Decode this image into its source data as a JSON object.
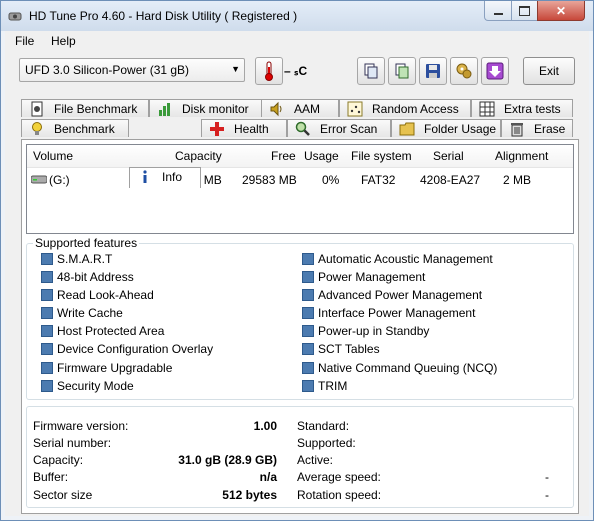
{
  "window": {
    "title": "HD Tune Pro 4.60 - Hard Disk Utility (  Registered )"
  },
  "menu": [
    "File",
    "Help"
  ],
  "toolbar": {
    "drive": "UFD 3.0 Silicon-Power    (31 gB)",
    "temperature": "– ₛC",
    "exit": "Exit"
  },
  "tabs_top": [
    "File Benchmark",
    "Disk monitor",
    "AAM",
    "Random Access",
    "Extra tests"
  ],
  "tabs_bottom": [
    "Benchmark",
    "Info",
    "Health",
    "Error Scan",
    "Folder Usage",
    "Erase"
  ],
  "active_tab": "Info",
  "volume_table": {
    "headers": [
      "Volume",
      "Capacity",
      "Free",
      "Usage",
      "File system",
      "Serial",
      "Alignment"
    ],
    "rows": [
      [
        "(G:)",
        "29584 MB",
        "29583 MB",
        "0%",
        "FAT32",
        "4208-EA27",
        "2 MB"
      ]
    ]
  },
  "features": {
    "legend": "Supported features",
    "left": [
      "S.M.A.R.T",
      "48-bit Address",
      "Read Look-Ahead",
      "Write Cache",
      "Host Protected Area",
      "Device Configuration Overlay",
      "Firmware Upgradable",
      "Security Mode"
    ],
    "right": [
      "Automatic Acoustic Management",
      "Power Management",
      "Advanced Power Management",
      "Interface Power Management",
      "Power-up in Standby",
      "SCT Tables",
      "Native Command Queuing (NCQ)",
      "TRIM"
    ]
  },
  "details": {
    "left": [
      {
        "label": "Firmware version:",
        "value": "1.00"
      },
      {
        "label": "Serial number:",
        "value": ""
      },
      {
        "label": "Capacity:",
        "value": "31.0 gB (28.9 GB)"
      },
      {
        "label": "Buffer:",
        "value": "n/a"
      },
      {
        "label": "Sector size",
        "value": "512 bytes"
      }
    ],
    "right": [
      {
        "label": "Standard:",
        "value": ""
      },
      {
        "label": "Supported:",
        "value": ""
      },
      {
        "label": "Active:",
        "value": ""
      },
      {
        "label": "Average speed:",
        "value": "-"
      },
      {
        "label": "Rotation speed:",
        "value": "-"
      }
    ]
  }
}
